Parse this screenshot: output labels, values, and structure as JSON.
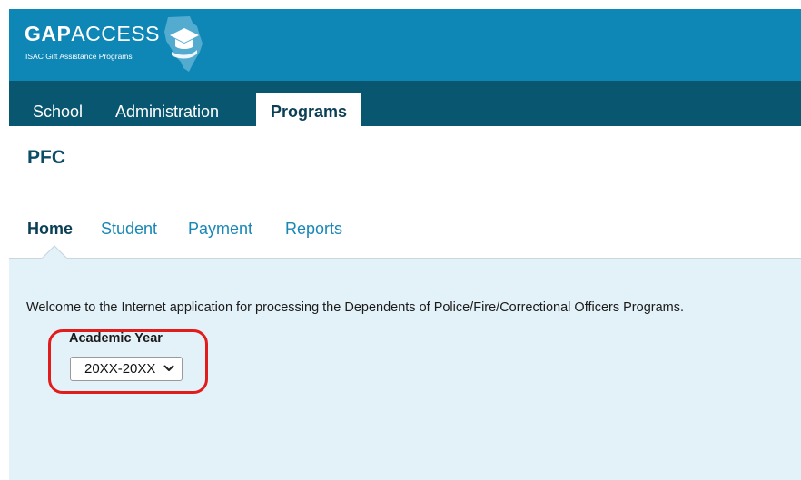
{
  "header": {
    "logo_bold": "GAP",
    "logo_light": "ACCESS",
    "logo_subtitle": "ISAC Gift Assistance Programs"
  },
  "topnav": {
    "items": [
      {
        "label": "School"
      },
      {
        "label": "Administration"
      },
      {
        "label": "Programs",
        "active": true
      }
    ]
  },
  "page": {
    "title": "PFC"
  },
  "subtabs": {
    "items": [
      {
        "label": "Home",
        "active": true
      },
      {
        "label": "Student"
      },
      {
        "label": "Payment"
      },
      {
        "label": "Reports"
      }
    ]
  },
  "main": {
    "welcome_text": "Welcome to the Internet application for processing the Dependents of Police/Fire/Correctional Officers Programs.",
    "academic_year": {
      "label": "Academic Year",
      "selected_value": "20XX-20XX"
    }
  },
  "colors": {
    "header_bg": "#0e86b6",
    "topnav_bg": "#08566f",
    "panel_bg": "#e3f1f8",
    "link": "#1787b6",
    "highlight": "#e21b1b"
  },
  "icons": {
    "logo_mark": "illinois-state-cap-icon",
    "select_arrow": "chevron-down-icon"
  }
}
